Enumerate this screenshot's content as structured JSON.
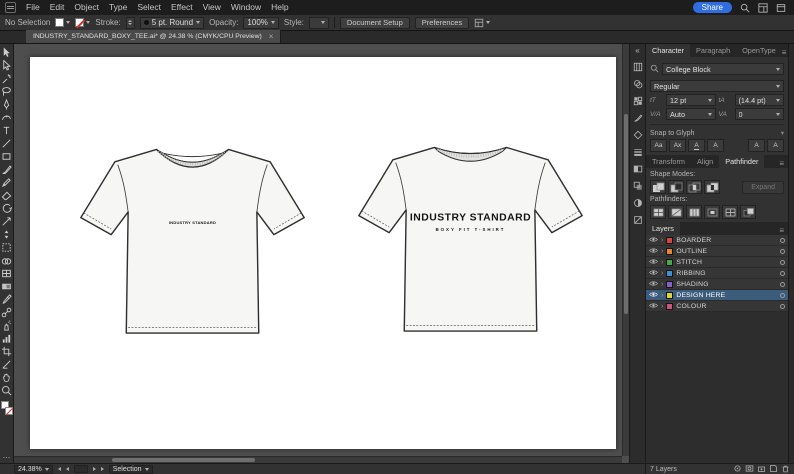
{
  "app": {
    "share_label": "Share"
  },
  "glyphs": {
    "close": "×",
    "collapse": "«",
    "panel_menu": "≡",
    "more": "…"
  },
  "menubar": {
    "items": [
      "File",
      "Edit",
      "Object",
      "Type",
      "Select",
      "Effect",
      "View",
      "Window",
      "Help"
    ]
  },
  "controlbar": {
    "no_selection": "No Selection",
    "stroke_label": "Stroke:",
    "brush_value": "5 pt. Round",
    "opacity_label": "Opacity:",
    "opacity_value": "100%",
    "style_label": "Style:",
    "document_setup_label": "Document Setup",
    "preferences_label": "Preferences"
  },
  "tabbar": {
    "title": "INDUSTRY_STANDARD_BOXY_TEE.ai* @ 24.38 % (CMYK/CPU Preview)"
  },
  "artboard": {
    "front_text": "INDUSTRY STANDARD",
    "back_title": "INDUSTRY STANDARD",
    "back_subtitle": "BOXY FIT T-SHIRT"
  },
  "character_panel": {
    "tabs": [
      "Character",
      "Paragraph",
      "OpenType"
    ],
    "font_name": "College Block",
    "font_style": "Regular",
    "font_size": "12 pt",
    "leading": "(14.4 pt)",
    "kerning": "Auto",
    "tracking": "0",
    "snap_to_glyph_label": "Snap to Glyph",
    "icons": {
      "size": "tT",
      "leading": "tA",
      "kerning": "V/A",
      "tracking": "VA",
      "g1": "Aa",
      "g2": "Ax",
      "g3": "A",
      "g4": "A",
      "g5": "A",
      "g6": "A"
    }
  },
  "pathfinder_panel": {
    "tabs": [
      "Transform",
      "Align",
      "Pathfinder"
    ],
    "shape_modes_label": "Shape Modes:",
    "pathfinders_label": "Pathfinders:",
    "expand_label": "Expand"
  },
  "layers_panel": {
    "tab_label": "Layers",
    "items": [
      {
        "name": "BOARDER",
        "chip_style": "background:#d64541"
      },
      {
        "name": "OUTLINE",
        "chip_style": "background:#e8843a"
      },
      {
        "name": "STITCH",
        "chip_style": "background:#46a84c"
      },
      {
        "name": "RIBBING",
        "chip_style": "background:#3f8fd2"
      },
      {
        "name": "SHADING",
        "chip_style": "background:#8a5fc8"
      },
      {
        "name": "DESIGN HERE",
        "chip_style": "background:#e0d23e"
      },
      {
        "name": "COLOUR",
        "chip_style": "background:#d2527f"
      }
    ],
    "count_label": "7 Layers"
  },
  "statusbar": {
    "zoom": "24.38%",
    "tool": "Selection"
  }
}
